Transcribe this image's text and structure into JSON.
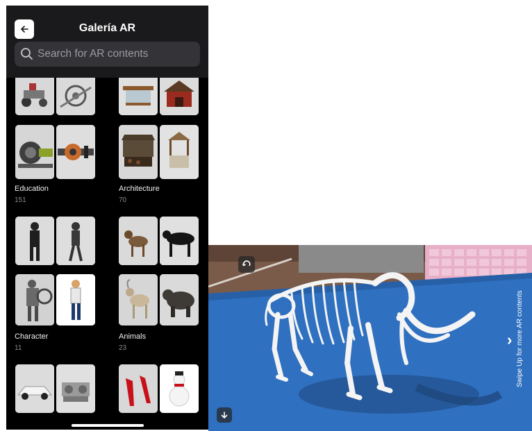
{
  "header": {
    "title": "Galería AR",
    "search_placeholder": "Search for AR contents"
  },
  "categories": [
    {
      "label": "Education",
      "count": "151"
    },
    {
      "label": "Architecture",
      "count": "70"
    },
    {
      "label": "Character",
      "count": "11"
    },
    {
      "label": "Animals",
      "count": "23"
    }
  ],
  "ar_view": {
    "swipe_hint": "Swipe Up for more AR contents",
    "next_symbol": "›"
  },
  "colors": {
    "background": "#000000",
    "header": "#1a1a1c",
    "search_field": "#333338",
    "ar_mat": "#2f70c0"
  }
}
